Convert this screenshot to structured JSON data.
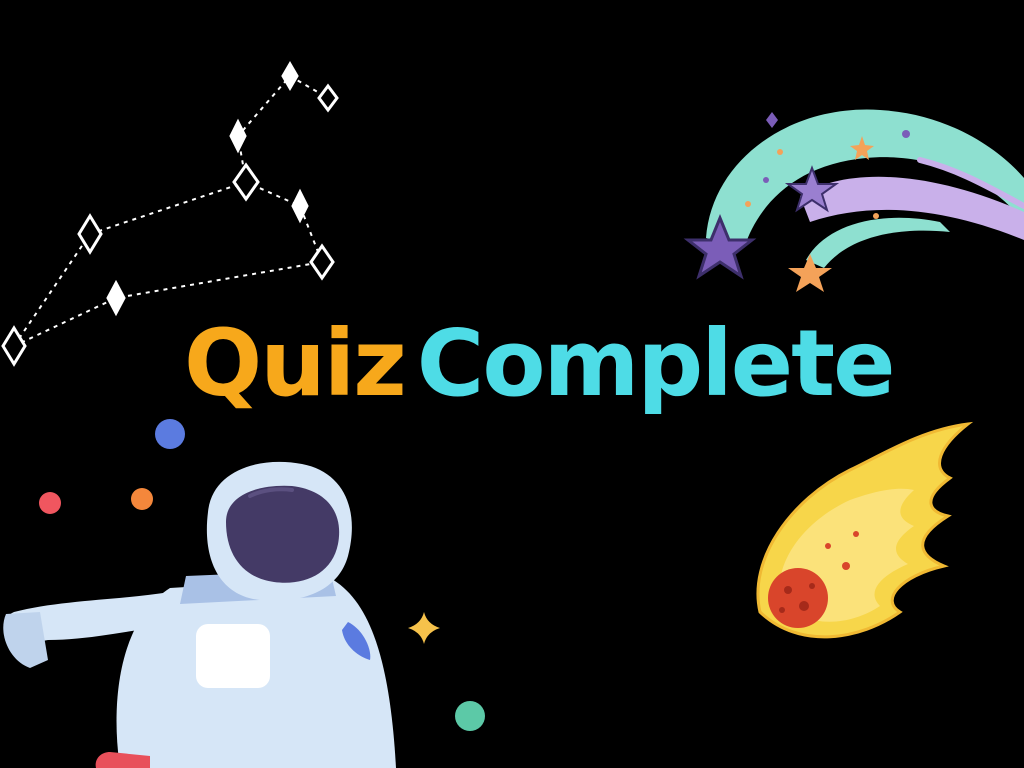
{
  "slide": {
    "title_word_1": "Quiz",
    "title_word_2": "Complete"
  },
  "colors": {
    "background": "#000000",
    "title_word_1": "#F7A81B",
    "title_word_2": "#4EDCE6",
    "constellation": "#FFFFFF",
    "comet_teal": "#8EE0D0",
    "comet_lavender": "#C9B0EA",
    "star_purple": "#7B5DB8",
    "star_orange": "#F4A259",
    "meteor_yellow": "#F7D64A",
    "meteor_core": "#D9452B",
    "astronaut_suit": "#D6E6F7",
    "astronaut_visor": "#443A66"
  },
  "icons": [
    "constellation-icon",
    "comet-stars-icon",
    "astronaut-icon",
    "meteor-icon",
    "dot-icon",
    "sparkle-icon"
  ]
}
